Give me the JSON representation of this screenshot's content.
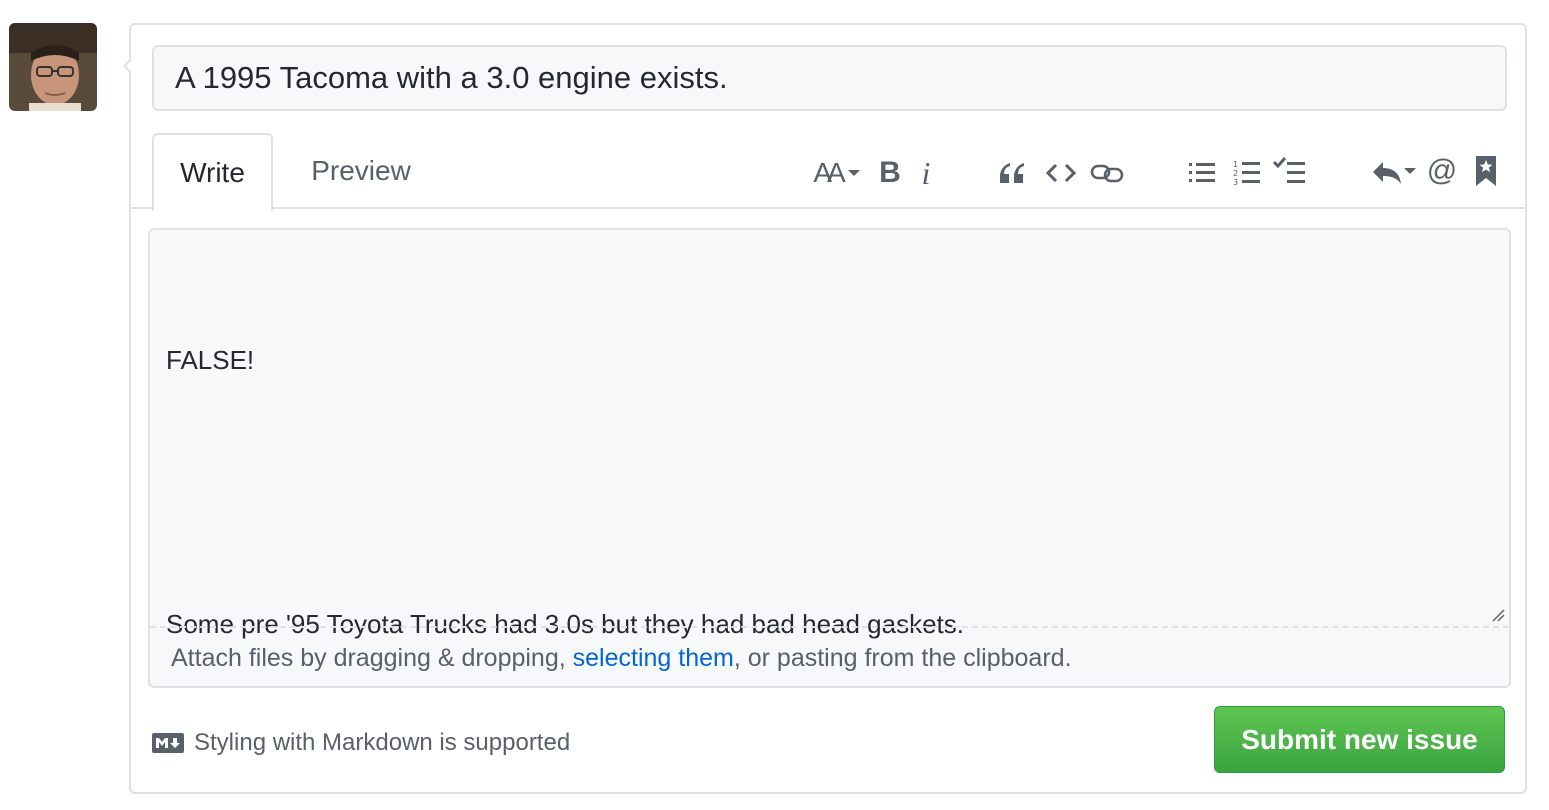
{
  "avatar": {
    "alt": "user avatar"
  },
  "issue": {
    "title": "A 1995 Tacoma with a 3.0 engine exists.",
    "body_lines": [
      "FALSE!",
      "",
      "Some pre '95 Toyota Trucks had 3.0s but they had bad head gaskets."
    ]
  },
  "tabs": {
    "write": "Write",
    "preview": "Preview"
  },
  "toolbar": {
    "icons": [
      "text-size-icon",
      "bold-icon",
      "italic-icon",
      "quote-icon",
      "code-icon",
      "link-icon",
      "unordered-list-icon",
      "ordered-list-icon",
      "task-list-icon",
      "reply-icon",
      "mention-icon",
      "bookmark-icon"
    ],
    "bold_glyph": "B",
    "italic_glyph": "i",
    "mention_glyph": "@",
    "text_size_glyph": "AA"
  },
  "attach": {
    "prefix": "Attach files by dragging & dropping, ",
    "link": "selecting them",
    "suffix": ", or pasting from the clipboard."
  },
  "markdown_note": "Styling with Markdown is supported",
  "submit_label": "Submit new issue",
  "colors": {
    "link": "#0366d6",
    "submit_green": "#3aa33f",
    "border": "#dfe2e5"
  }
}
